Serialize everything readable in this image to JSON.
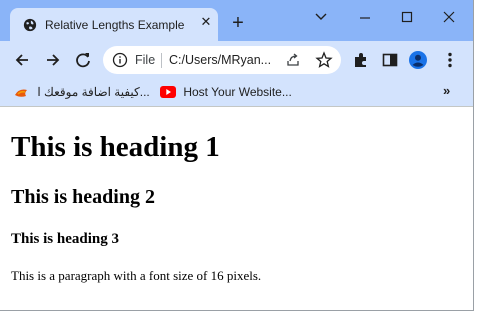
{
  "colors": {
    "tabstrip": "#8ab4f8",
    "toolbar": "#d3e3fd",
    "youtube_red": "#ff0000"
  },
  "tab": {
    "title": "Relative Lengths Example",
    "favicon": "globe-icon"
  },
  "window_controls": [
    "chevron-down-icon",
    "minimize-icon",
    "maximize-icon",
    "close-icon"
  ],
  "omnibox": {
    "scheme_label": "File",
    "url": "C:/Users/MRyan..."
  },
  "bookmarks": [
    {
      "label": "كيفية اضافة موقعك ا...",
      "icon": "bookmark-favicon-icon"
    },
    {
      "label": "Host Your Website...",
      "icon": "youtube-icon"
    }
  ],
  "page": {
    "heading1": "This is heading 1",
    "heading2": "This is heading 2",
    "heading3": "This is heading 3",
    "paragraph": "This is a paragraph with a font size of 16 pixels."
  }
}
